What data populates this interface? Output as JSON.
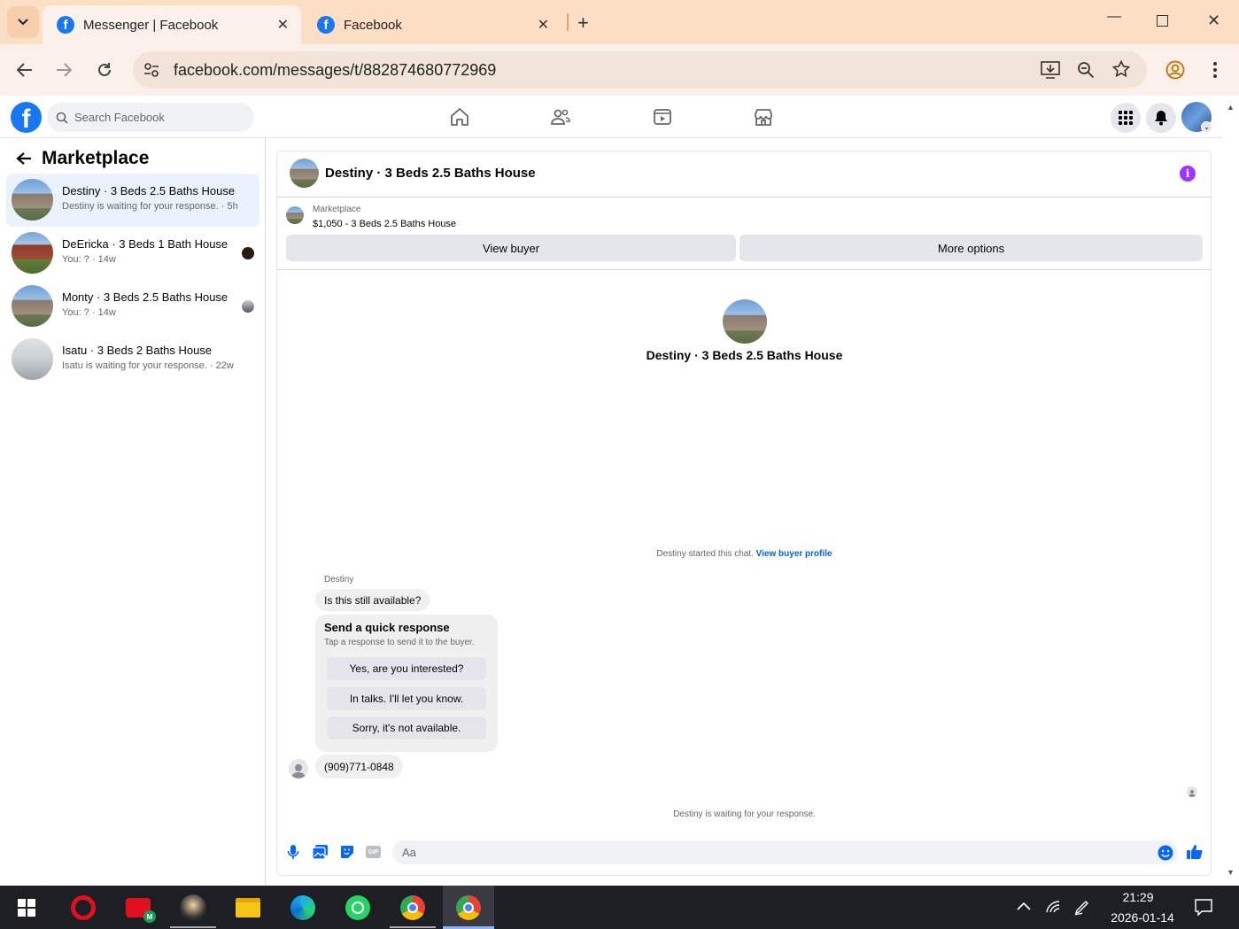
{
  "browser": {
    "tabs": [
      {
        "title": "Messenger | Facebook",
        "active": true
      },
      {
        "title": "Facebook",
        "active": false
      }
    ],
    "url": "facebook.com/messages/t/882874680772969"
  },
  "fb_header": {
    "search_placeholder": "Search Facebook"
  },
  "sidebar": {
    "title": "Marketplace",
    "conversations": [
      {
        "name": "Destiny · 3 Beds 2.5 Baths House",
        "preview": "Destiny is waiting for your response.",
        "time": "· 5h",
        "selected": true
      },
      {
        "name": "DeEricka · 3 Beds 1 Bath House",
        "preview": "You: ?",
        "time": "· 14w",
        "selected": false
      },
      {
        "name": "Monty · 3 Beds 2.5 Baths House",
        "preview": "You: ?",
        "time": "· 14w",
        "selected": false
      },
      {
        "name": "Isatu · 3 Beds 2 Baths House",
        "preview": "Isatu is waiting for your response.",
        "time": "· 22w",
        "selected": false
      }
    ]
  },
  "chat": {
    "header_title": "Destiny · 3 Beds 2.5 Baths House",
    "listing_label": "Marketplace",
    "listing_title": "$1,050 - 3 Beds 2.5 Baths House",
    "view_buyer": "View buyer",
    "more_options": "More options",
    "profile_name": "Destiny · 3 Beds 2.5 Baths House",
    "started_text": "Destiny started this chat.",
    "view_profile_link": "View buyer profile",
    "sender_name": "Destiny",
    "message1": "Is this still available?",
    "quick_title": "Send a quick response",
    "quick_sub": "Tap a response to send it to the buyer.",
    "quick_responses": [
      "Yes, are you interested?",
      "In talks. I'll let you know.",
      "Sorry, it's not available."
    ],
    "message2": "(909)771-0848",
    "waiting_text": "Destiny is waiting for your response.",
    "composer_placeholder": "Aa"
  },
  "taskbar": {
    "time": "21:29",
    "date": "2026-01-14"
  },
  "colors": {
    "fb_blue": "#1877f2",
    "chrome_tab": "#fddfc5",
    "info_purple": "#a033ff"
  }
}
